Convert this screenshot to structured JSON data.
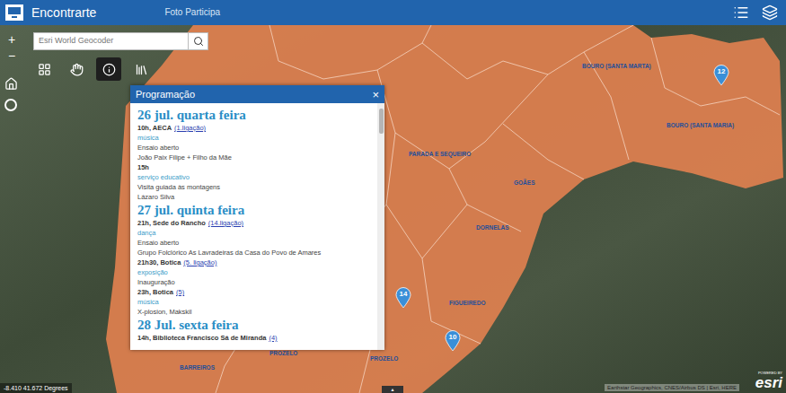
{
  "app": {
    "title": "Encontrarte",
    "subtitle": "Foto Participa"
  },
  "search": {
    "placeholder": "Esri World Geocoder"
  },
  "zoom": {
    "in": "+",
    "out": "−"
  },
  "toolbar": [
    {
      "kind": "basemap",
      "selected": false
    },
    {
      "kind": "hand",
      "selected": false
    },
    {
      "kind": "info",
      "selected": true
    },
    {
      "kind": "library",
      "selected": false
    }
  ],
  "popup": {
    "title": "Programação",
    "close": "×",
    "days": [
      {
        "heading": "26 jul. quarta feira",
        "lines": [
          {
            "kind": "time",
            "text": "10h, AECA",
            "link": "(1.ligação)"
          },
          {
            "kind": "category",
            "text": "música"
          },
          {
            "kind": "text",
            "text": "Ensaio aberto"
          },
          {
            "kind": "text",
            "text": "João Paix Filipe + Filho da Mãe"
          },
          {
            "kind": "time",
            "text": "15h",
            "link": ""
          },
          {
            "kind": "category",
            "text": "serviço educativo"
          },
          {
            "kind": "text",
            "text": "Visita guiada às montagens"
          },
          {
            "kind": "text",
            "text": "Lázaro Silva"
          }
        ]
      },
      {
        "heading": "27 jul. quinta feira",
        "lines": [
          {
            "kind": "time",
            "text": "21h, Sede do Rancho",
            "link": "(14.ligação)"
          },
          {
            "kind": "category",
            "text": "dança"
          },
          {
            "kind": "text",
            "text": "Ensaio aberto"
          },
          {
            "kind": "text",
            "text": "Grupo Folclórico As Lavradeiras da Casa do Povo de Amares"
          },
          {
            "kind": "time",
            "text": "21h30, Botica",
            "link": "(5. ligação)"
          },
          {
            "kind": "category",
            "text": "exposição"
          },
          {
            "kind": "text",
            "text": "Inauguração"
          },
          {
            "kind": "time",
            "text": "23h, Botica",
            "link": "(5)"
          },
          {
            "kind": "category",
            "text": "música"
          },
          {
            "kind": "text",
            "text": "X-plosion, Makskil"
          }
        ]
      },
      {
        "heading": "28 Jul. sexta feira",
        "lines": [
          {
            "kind": "time",
            "text": "14h, Biblioteca Francisco Sá de Miranda",
            "link": "(4)"
          }
        ]
      }
    ]
  },
  "map_labels": [
    "BOURO (SANTA MARTA)",
    "BOURO (SANTA MARIA)",
    "PARADA E SEQUEIRO",
    "GOÃES",
    "DORNELAS",
    "FIGUEIREDO",
    "PROZELO",
    "PROZELO",
    "BARREIROS"
  ],
  "pins": [
    {
      "label": "12"
    },
    {
      "label": "14"
    },
    {
      "label": "10"
    }
  ],
  "coordinates": "-8.410 41.672 Degrees",
  "attribution": "Earthstar Geographics, CNES/Airbus DS | Esri, HERE",
  "logo": {
    "powered": "POWERED BY",
    "name": "esri"
  },
  "bottom_tab": "▲"
}
